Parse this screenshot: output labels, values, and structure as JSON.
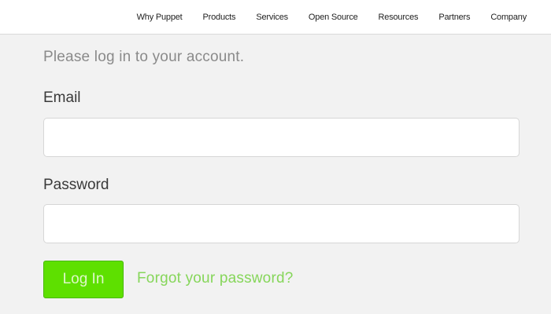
{
  "header": {
    "nav_items": [
      {
        "label": "Why Puppet"
      },
      {
        "label": "Products"
      },
      {
        "label": "Services"
      },
      {
        "label": "Open Source"
      },
      {
        "label": "Resources"
      },
      {
        "label": "Partners"
      },
      {
        "label": "Company"
      }
    ]
  },
  "login": {
    "intro": "Please log in to your account.",
    "email_label": "Email",
    "email_value": "",
    "password_label": "Password",
    "password_value": "",
    "submit_label": "Log In",
    "forgot_label": "Forgot your password?"
  },
  "colors": {
    "accent_green": "#5ee000",
    "link_green": "#86d65a",
    "background": "#f2f2f2"
  }
}
